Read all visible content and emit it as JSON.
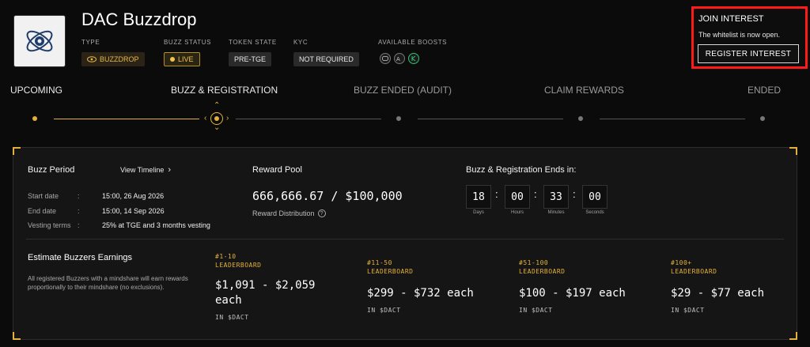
{
  "project": {
    "title": "DAC Buzzdrop",
    "type_label": "TYPE",
    "type_value": "BUZZDROP",
    "status_label": "BUZZ STATUS",
    "status_value": "LIVE",
    "token_label": "TOKEN STATE",
    "token_value": "PRE-TGE",
    "kyc_label": "KYC",
    "kyc_value": "NOT REQUIRED",
    "boosts_label": "AVAILABLE BOOSTS"
  },
  "join": {
    "title": "JOIN INTEREST",
    "subtitle": "The whitelist is now open.",
    "button": "REGISTER INTEREST"
  },
  "timeline": {
    "stages": [
      "UPCOMING",
      "BUZZ & REGISTRATION",
      "BUZZ ENDED (AUDIT)",
      "CLAIM REWARDS",
      "ENDED"
    ],
    "active_index": 1
  },
  "buzz_period": {
    "title": "Buzz Period",
    "view_timeline": "View Timeline",
    "start_label": "Start date",
    "start_value": "15:00, 26 Aug 2026",
    "end_label": "End date",
    "end_value": "15:00, 14 Sep 2026",
    "vesting_label": "Vesting terms",
    "vesting_value": "25% at TGE and 3 months vesting"
  },
  "reward_pool": {
    "title": "Reward Pool",
    "value": "666,666.67 / $100,000",
    "distribution": "Reward Distribution"
  },
  "countdown": {
    "title": "Buzz & Registration Ends in",
    "days": "18",
    "hours": "00",
    "minutes": "33",
    "seconds": "00",
    "days_label": "Days",
    "hours_label": "Hours",
    "minutes_label": "Minutes",
    "seconds_label": "Seconds"
  },
  "earnings": {
    "title": "Estimate Buzzers Earnings",
    "description": "All registered Buzzers with a mindshare will earn rewards proportionally to their mindshare (no exclusions).",
    "tiers": [
      {
        "rank": "#1-10",
        "board": "LEADERBOARD",
        "amount": "$1,091 - $2,059",
        "amount2": "each",
        "unit": "IN $DACT"
      },
      {
        "rank": "#11-50",
        "board": "LEADERBOARD",
        "amount": "$299 - $732 each",
        "amount2": "",
        "unit": "IN $DACT"
      },
      {
        "rank": "#51-100",
        "board": "LEADERBOARD",
        "amount": "$100 - $197 each",
        "amount2": "",
        "unit": "IN $DACT"
      },
      {
        "rank": "#100+",
        "board": "LEADERBOARD",
        "amount": "$29 - $77 each",
        "amount2": "",
        "unit": "IN $DACT"
      }
    ]
  },
  "colors": {
    "accent": "#e2b13c",
    "highlight_border": "#ff1a1a",
    "background": "#0b0b0b"
  }
}
